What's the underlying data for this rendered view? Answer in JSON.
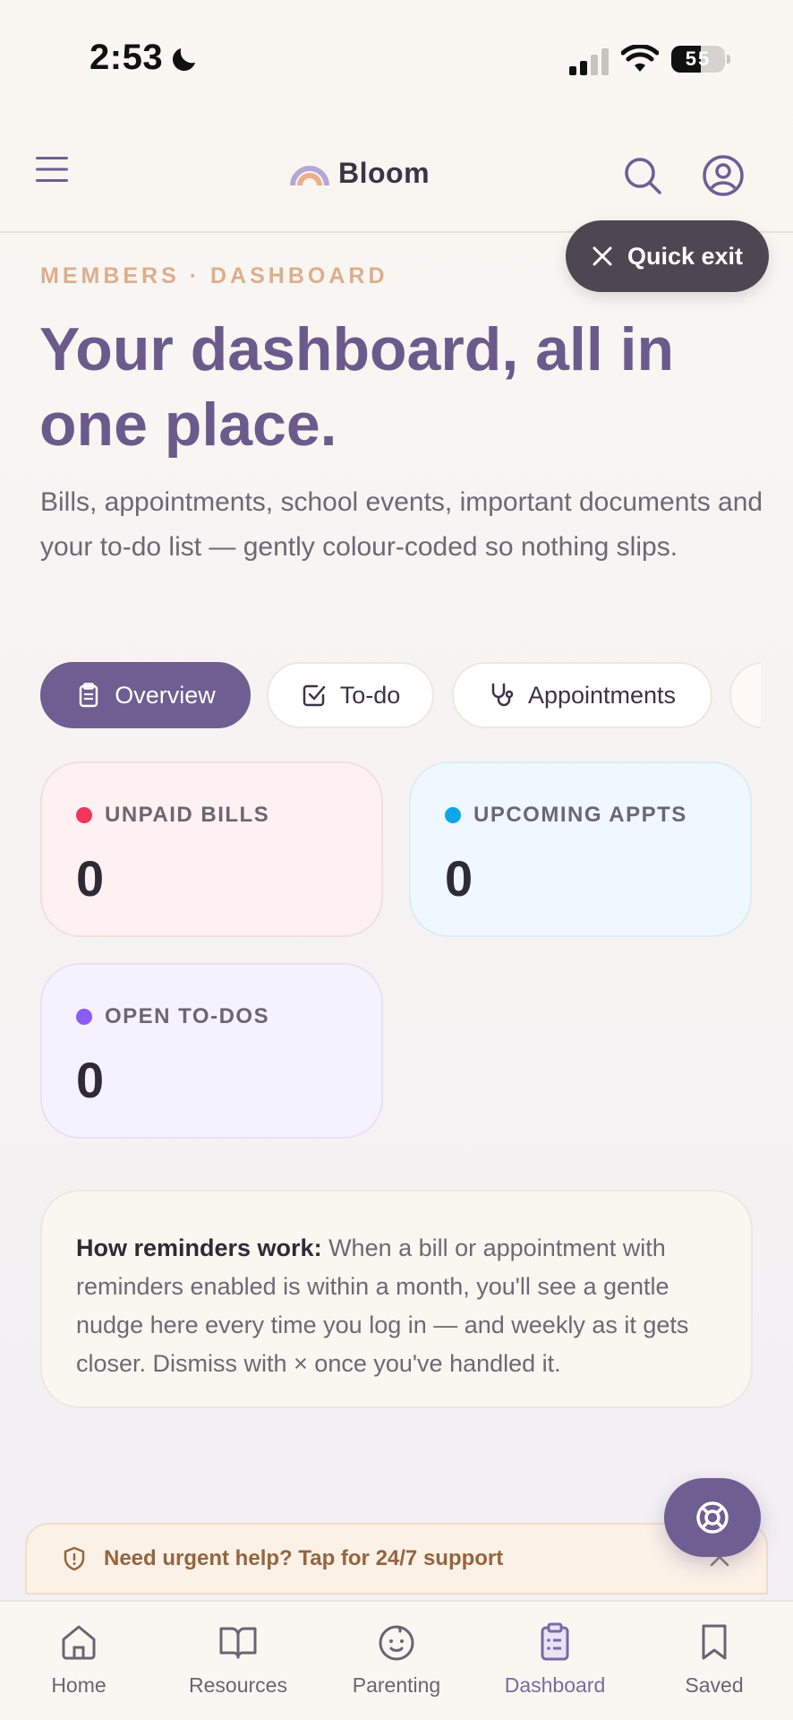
{
  "status_bar": {
    "time": "2:53",
    "battery": "55"
  },
  "header": {
    "brand": "Bloom"
  },
  "quick_exit": {
    "label": "Quick exit"
  },
  "eyebrow": "MEMBERS · DASHBOARD",
  "title": "Your dashboard, all in one place.",
  "subtitle": "Bills, appointments, school events, important documents and your to-do list — gently colour-coded so nothing slips.",
  "tabs": [
    {
      "label": "Overview",
      "active": true
    },
    {
      "label": "To-do",
      "active": false
    },
    {
      "label": "Appointments",
      "active": false
    }
  ],
  "stats": [
    {
      "label": "UNPAID BILLS",
      "value": "0",
      "color": "#f0365a"
    },
    {
      "label": "UPCOMING APPTS",
      "value": "0",
      "color": "#0ea5e9"
    },
    {
      "label": "OPEN TO-DOS",
      "value": "0",
      "color": "#8b5cf6"
    }
  ],
  "info": {
    "heading": "How reminders work:",
    "body": " When a bill or appointment with reminders enabled is within a month, you'll see a gentle nudge here every time you log in — and weekly as it gets closer. Dismiss with × once you've handled it."
  },
  "urgent_banner": {
    "label": "Need urgent help? Tap for 24/7 support"
  },
  "bottom_nav": [
    {
      "label": "Home"
    },
    {
      "label": "Resources"
    },
    {
      "label": "Parenting"
    },
    {
      "label": "Dashboard",
      "active": true
    },
    {
      "label": "Saved"
    }
  ],
  "colors": {
    "primary": "#6f5e92",
    "title": "#6b5b8c",
    "eyebrow": "#dcae8e",
    "quick_exit_bg": "#4e4752"
  }
}
